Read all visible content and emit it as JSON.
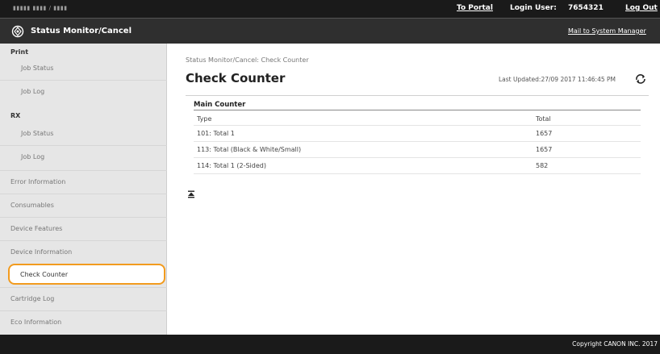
{
  "topbar": {
    "device_name": "▮▮▮▮▮  ▮▮▮▮ / ▮▮▮▮",
    "to_portal": "To Portal",
    "login_label": "Login User:",
    "login_user": "7654321",
    "logout": "Log Out"
  },
  "titlebar": {
    "title": "Status Monitor/Cancel",
    "mail_link": "Mail to System Manager",
    "icon": "status-monitor-icon"
  },
  "sidebar": {
    "print_head": "Print",
    "print_items": [
      "Job Status",
      "Job Log"
    ],
    "rx_head": "RX",
    "rx_items": [
      "Job Status",
      "Job Log"
    ],
    "items": [
      "Error Information",
      "Consumables",
      "Device Features",
      "Device Information",
      "Check Counter",
      "Cartridge Log",
      "Eco Information"
    ],
    "selected": "Check Counter",
    "selected_color": "#f29b1e"
  },
  "main": {
    "breadcrumb": "Status Monitor/Cancel: Check Counter",
    "title": "Check Counter",
    "last_updated": "Last Updated:27/09 2017 11:46:45 PM",
    "refresh_icon": "refresh-icon",
    "counter": {
      "heading": "Main Counter",
      "columns": [
        "Type",
        "Total"
      ],
      "rows": [
        {
          "type": "101: Total 1",
          "total": "1657"
        },
        {
          "type": "113: Total (Black & White/Small)",
          "total": "1657"
        },
        {
          "type": "114: Total 1 (2-Sided)",
          "total": "582"
        }
      ]
    },
    "top_icon": "back-to-top-icon"
  },
  "footer": {
    "copyright": "Copyright CANON INC. 2017"
  }
}
